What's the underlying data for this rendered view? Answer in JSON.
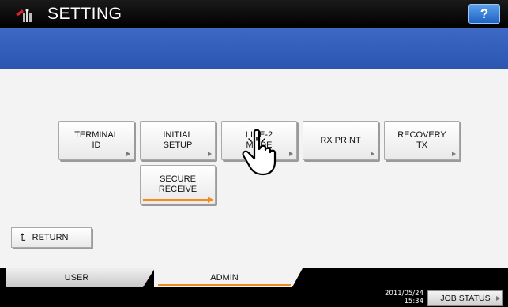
{
  "header": {
    "title": "SETTING",
    "title_icon": "settings-tools-icon",
    "help_label": "?"
  },
  "functions": [
    {
      "id": "terminal-id",
      "label": "TERMINAL\nID"
    },
    {
      "id": "initial-setup",
      "label": "INITIAL\nSETUP"
    },
    {
      "id": "line-2-mode",
      "label": "LINE-2\nMODE"
    },
    {
      "id": "rx-print",
      "label": "RX PRINT"
    },
    {
      "id": "recovery-tx",
      "label": "RECOVERY\nTX"
    },
    {
      "id": "secure-receive",
      "label": "SECURE\nRECEIVE"
    }
  ],
  "return_label": "RETURN",
  "tabs": {
    "user": "USER",
    "admin": "ADMIN",
    "active": "admin"
  },
  "footer": {
    "date": "2011/05/24",
    "time": "15:34",
    "job_status_label": "JOB STATUS"
  },
  "colors": {
    "accent_blue": "#2a56b0",
    "accent_orange": "#f08a1a",
    "help_blue": "#1f63c6"
  }
}
